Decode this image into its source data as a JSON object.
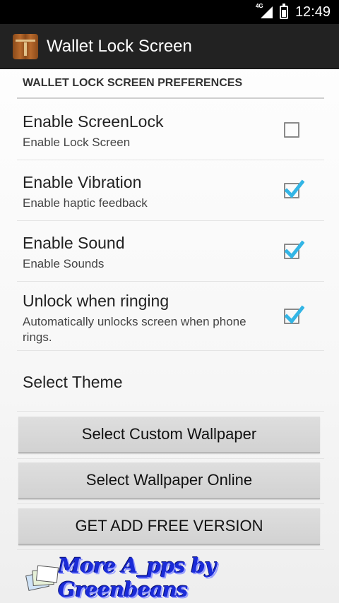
{
  "status_bar": {
    "network": "4G",
    "time": "12:49"
  },
  "action_bar": {
    "title": "Wallet Lock Screen",
    "icon": "wallet-zipper-icon"
  },
  "category": {
    "title": "WALLET LOCK SCREEN PREFERENCES"
  },
  "preferences": [
    {
      "title": "Enable ScreenLock",
      "summary": "Enable Lock Screen",
      "checked": false
    },
    {
      "title": "Enable Vibration",
      "summary": "Enable haptic feedback",
      "checked": true
    },
    {
      "title": "Enable Sound",
      "summary": "Enable Sounds",
      "checked": true
    },
    {
      "title": "Unlock when ringing",
      "summary": "Automatically unlocks screen when phone rings.",
      "checked": true
    },
    {
      "title": "Select Theme"
    }
  ],
  "buttons": {
    "custom_wallpaper": "Select Custom Wallpaper",
    "wallpaper_online": "Select Wallpaper Online",
    "free_version": "GET ADD FREE VERSION"
  },
  "banner": {
    "text": "More A_pps by Greenbeans"
  },
  "colors": {
    "accent_check": "#33b5e5",
    "action_bar": "#222222",
    "banner_text": "#1a2bd8"
  }
}
